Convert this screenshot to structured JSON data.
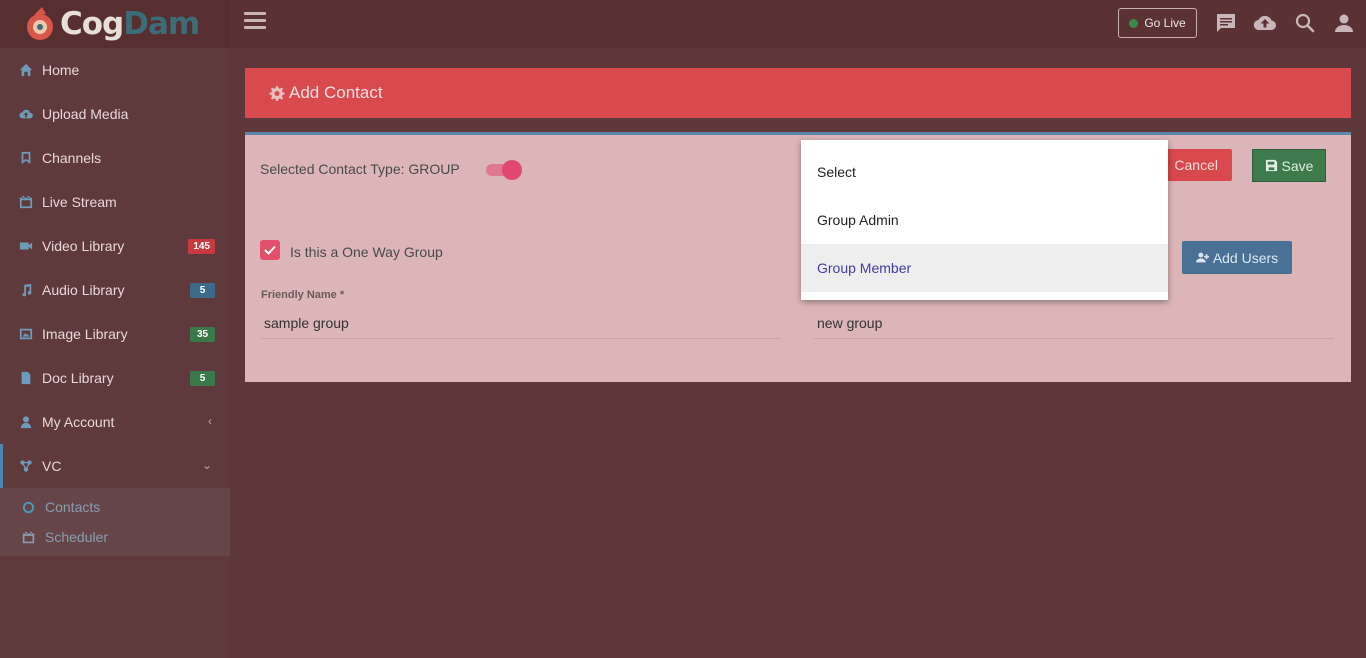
{
  "brand": {
    "part1": "Cog",
    "part2": "Dam"
  },
  "sidebar": {
    "items": [
      {
        "label": "Home",
        "icon": "home-icon"
      },
      {
        "label": "Upload Media",
        "icon": "cloud-upload-icon"
      },
      {
        "label": "Channels",
        "icon": "bookmark-icon"
      },
      {
        "label": "Live Stream",
        "icon": "calendar-icon"
      },
      {
        "label": "Video Library",
        "icon": "video-icon",
        "badge": "145"
      },
      {
        "label": "Audio Library",
        "icon": "music-icon",
        "badge": "5"
      },
      {
        "label": "Image Library",
        "icon": "image-icon",
        "badge": "35"
      },
      {
        "label": "Doc Library",
        "icon": "file-icon",
        "badge": "5"
      },
      {
        "label": "My Account",
        "icon": "user-icon"
      },
      {
        "label": "VC",
        "icon": "network-icon"
      }
    ],
    "submenu": [
      {
        "label": "Contacts",
        "icon": "circle-icon"
      },
      {
        "label": "Scheduler",
        "icon": "calendar-icon"
      }
    ]
  },
  "topbar": {
    "go_live": "Go Live"
  },
  "form": {
    "title": "Add Contact",
    "contact_type": "Selected Contact Type: GROUP",
    "one_way_label": "Is this a One Way Group",
    "friendly_name_label": "Friendly Name",
    "required_mark": "*",
    "friendly_name_value": "sample group",
    "second_value": "new group",
    "cancel_label": "Cancel",
    "save_label": "Save",
    "add_users_label": "Add Users"
  },
  "dropdown": {
    "options": [
      "Select",
      "Group Admin",
      "Group Member"
    ],
    "selected": "Group Member"
  },
  "colors": {
    "header_red": "#d94a4e",
    "accent_blue": "#4a86b0",
    "save_green": "#3f7a4c"
  }
}
